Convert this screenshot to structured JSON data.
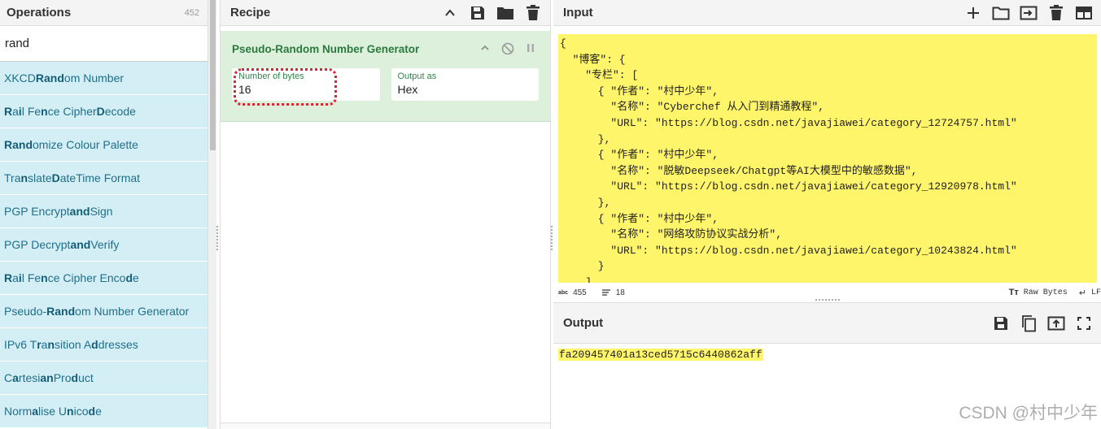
{
  "operations": {
    "title": "Operations",
    "count": "452",
    "search_value": "rand",
    "items": [
      {
        "segments": [
          [
            "XKCD ",
            false
          ],
          [
            "Rand",
            true
          ],
          [
            "om Number",
            false
          ]
        ]
      },
      {
        "segments": [
          [
            "R",
            true
          ],
          [
            "a",
            false
          ],
          [
            "i",
            true
          ],
          [
            "l Fe",
            false
          ],
          [
            "n",
            true
          ],
          [
            "ce Cipher ",
            false
          ],
          [
            "D",
            true
          ],
          [
            "ecode",
            false
          ]
        ]
      },
      {
        "segments": [
          [
            "Rand",
            true
          ],
          [
            "omize Colour Palette",
            false
          ]
        ]
      },
      {
        "segments": [
          [
            "Tra",
            false
          ],
          [
            "n",
            true
          ],
          [
            "slate ",
            false
          ],
          [
            "D",
            true
          ],
          [
            "ateTime Format",
            false
          ]
        ]
      },
      {
        "segments": [
          [
            "PGP Encrypt ",
            false
          ],
          [
            "and",
            true
          ],
          [
            " Sign",
            false
          ]
        ]
      },
      {
        "segments": [
          [
            "PGP Decrypt ",
            false
          ],
          [
            "and",
            true
          ],
          [
            " Verify",
            false
          ]
        ]
      },
      {
        "segments": [
          [
            "R",
            true
          ],
          [
            "a",
            false
          ],
          [
            "i",
            true
          ],
          [
            "l Fe",
            false
          ],
          [
            "n",
            true
          ],
          [
            "ce Cipher Enco",
            false
          ],
          [
            "d",
            true
          ],
          [
            "e",
            false
          ]
        ]
      },
      {
        "segments": [
          [
            "Pseudo-",
            false
          ],
          [
            "Rand",
            true
          ],
          [
            "om Number Generator",
            false
          ]
        ]
      },
      {
        "segments": [
          [
            "IPv6 T",
            false
          ],
          [
            "r",
            true
          ],
          [
            "a",
            false
          ],
          [
            "n",
            true
          ],
          [
            "sition A",
            false
          ],
          [
            "d",
            true
          ],
          [
            "dresses",
            false
          ]
        ]
      },
      {
        "segments": [
          [
            "C",
            false
          ],
          [
            "a",
            true
          ],
          [
            "rtesi",
            false
          ],
          [
            "an",
            true
          ],
          [
            " Pro",
            false
          ],
          [
            "d",
            true
          ],
          [
            "uct",
            false
          ]
        ]
      },
      {
        "segments": [
          [
            "Norm",
            false
          ],
          [
            "a",
            true
          ],
          [
            "lise U",
            false
          ],
          [
            "n",
            true
          ],
          [
            "ico",
            false
          ],
          [
            "d",
            true
          ],
          [
            "e",
            false
          ]
        ]
      }
    ]
  },
  "recipe": {
    "title": "Recipe",
    "operation": {
      "name": "Pseudo-Random Number Generator",
      "fields": [
        {
          "label": "Number of bytes",
          "value": "16"
        },
        {
          "label": "Output as",
          "value": "Hex"
        }
      ]
    }
  },
  "input": {
    "title": "Input",
    "text": "{\n  \"博客\": {\n    \"专栏\": [\n      { \"作者\": \"村中少年\",\n        \"名称\": \"Cyberchef 从入门到精通教程\",\n        \"URL\": \"https://blog.csdn.net/javajiawei/category_12724757.html\"\n      },\n      { \"作者\": \"村中少年\",\n        \"名称\": \"脱敏Deepseek/Chatgpt等AI大模型中的敏感数据\",\n        \"URL\": \"https://blog.csdn.net/javajiawei/category_12920978.html\"\n      },\n      { \"作者\": \"村中少年\",\n        \"名称\": \"网络攻防协议实战分析\",\n        \"URL\": \"https://blog.csdn.net/javajiawei/category_10243824.html\"\n      }\n    ]",
    "status": {
      "length_icon": "abc",
      "length": "455",
      "lines": "18",
      "format": "Raw Bytes",
      "eol": "LF"
    }
  },
  "output": {
    "title": "Output",
    "text": "fa209457401a13ced5715c6440862aff"
  },
  "watermark": "CSDN @村中少年",
  "colors": {
    "ops_item_bg": "#d4eef5",
    "recipe_card_bg": "#dcf0dc",
    "highlight_yellow": "#fff56b",
    "annotation_red": "#d9232e"
  }
}
